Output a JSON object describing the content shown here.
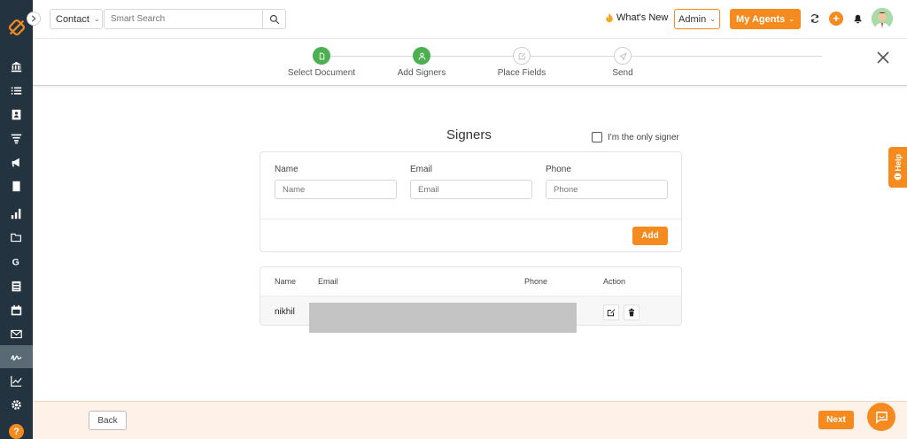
{
  "colors": {
    "accent": "#f58a1f",
    "sidebar": "#23333f",
    "success": "#4caf50"
  },
  "topbar": {
    "contact_label": "Contact",
    "search_placeholder": "Smart Search",
    "whats_new": "What's New",
    "admin_label": "Admin",
    "agents_label": "My Agents"
  },
  "stepper": {
    "steps": [
      {
        "label": "Select Document",
        "state": "done"
      },
      {
        "label": "Add Signers",
        "state": "done"
      },
      {
        "label": "Place Fields",
        "state": "todo"
      },
      {
        "label": "Send",
        "state": "todo"
      }
    ]
  },
  "signers": {
    "title": "Signers",
    "only_signer_label": "I'm the only signer",
    "form": {
      "name_label": "Name",
      "name_placeholder": "Name",
      "email_label": "Email",
      "email_placeholder": "Email",
      "phone_label": "Phone",
      "phone_placeholder": "Phone",
      "add_label": "Add"
    },
    "table": {
      "headers": [
        "Name",
        "Email",
        "Phone",
        "Action"
      ],
      "rows": [
        {
          "name": "nikhil"
        }
      ]
    }
  },
  "help_tab": "Help",
  "footer": {
    "back_label": "Back",
    "next_label": "Next"
  }
}
